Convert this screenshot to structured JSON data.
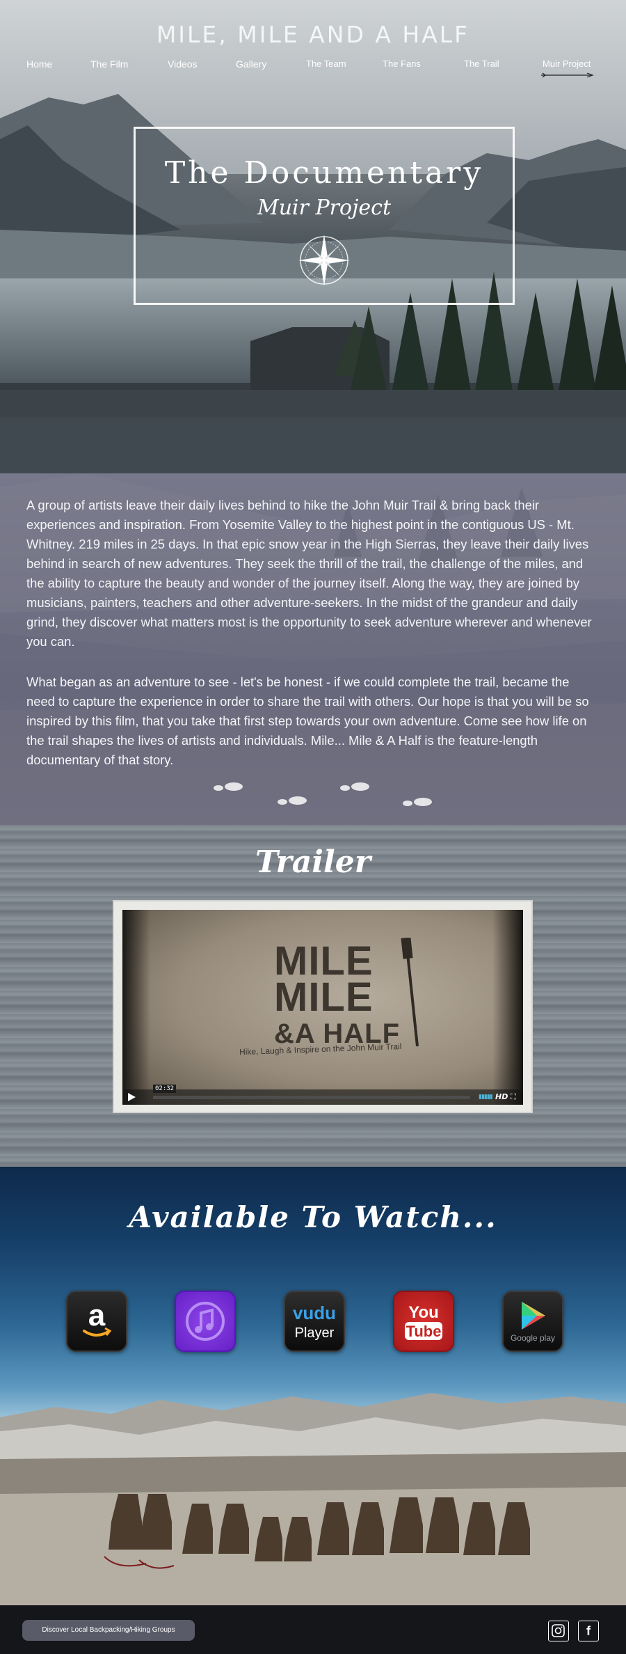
{
  "site": {
    "title": "MILE, MILE AND A HALF"
  },
  "nav": {
    "items": [
      {
        "label": "Home"
      },
      {
        "label": "The Film"
      },
      {
        "label": "Videos"
      },
      {
        "label": "Gallery"
      },
      {
        "label": "The Team"
      },
      {
        "label": "The Fans"
      },
      {
        "label": "The Trail"
      },
      {
        "label": "Muir Project"
      }
    ]
  },
  "hero": {
    "title": "The Documentary",
    "subtitle": "Muir Project"
  },
  "story": {
    "paragraph_1": "A group of artists leave their daily lives behind to hike the John Muir Trail & bring back their experiences and inspiration. From Yosemite Valley to the highest point in the contiguous US - Mt. Whitney. 219 miles in 25 days. In that epic snow year in the High Sierras, they leave their daily lives behind in search of new adventures. They seek the thrill of the trail, the challenge of the miles, and the ability to capture the beauty and wonder of the journey itself. Along the way, they are joined by musicians, painters, teachers and other adventure-seekers. In the midst of the grandeur and daily grind, they discover what matters most is the opportunity to seek adventure wherever and whenever you can.",
    "paragraph_2": "What began as an adventure to see - let's be honest - if we could complete the trail, became the need to capture the experience in order to share the trail with others.  Our hope is that you will be so inspired by this film, that you take that first step towards your own adventure. Come see how life on the trail shapes the lives of artists and individuals. Mile... Mile & A Half is the feature-length documentary of that story."
  },
  "trailer": {
    "title": "Trailer",
    "logo_line_1": "MILE",
    "logo_line_2": "MILE",
    "logo_line_3": "&A HALF",
    "tagline": "Hike, Laugh & Inspire on the John Muir Trail",
    "time": "02:32",
    "hd_label": "HD"
  },
  "watch": {
    "title": "Available To Watch...",
    "platforms": [
      {
        "name": "Amazon",
        "icon": "amazon-icon"
      },
      {
        "name": "iTunes",
        "icon": "itunes-icon"
      },
      {
        "name": "vudu",
        "icon_text": "Player",
        "icon": "vudu-icon"
      },
      {
        "name": "You Tube",
        "icon": "youtube-icon"
      },
      {
        "name": "Google play",
        "icon": "google-play-icon"
      }
    ]
  },
  "footer": {
    "discover_button": "Discover Local Backpacking/Hiking Groups",
    "social": [
      {
        "name": "instagram-icon"
      },
      {
        "name": "facebook-icon",
        "glyph": "f"
      }
    ]
  },
  "colors": {
    "story_bg": "#6f7083",
    "footer_bg": "#15161a",
    "button_bg": "#5a5b68",
    "itunes": "#7a33d9",
    "youtube": "#c42420"
  }
}
